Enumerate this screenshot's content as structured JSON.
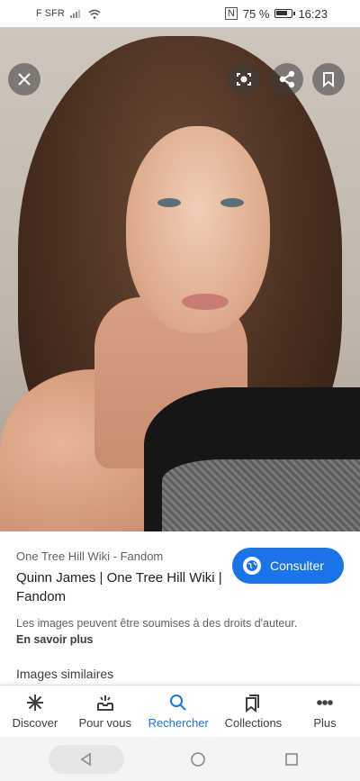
{
  "status_bar": {
    "carrier": "F SFR",
    "battery_percent": "75 %",
    "time": "16:23"
  },
  "hero": {
    "buttons": {
      "close": "close-icon",
      "lens": "lens-icon",
      "share": "share-icon",
      "bookmark": "bookmark-icon"
    }
  },
  "result": {
    "source": "One Tree Hill Wiki - Fandom",
    "title": "Quinn James | One Tree Hill Wiki | Fandom",
    "consult_label": "Consulter",
    "rights_text": "Les images peuvent être soumises à des droits d'auteur.",
    "learn_more": "En savoir plus",
    "similar_heading": "Images similaires"
  },
  "bottom_nav": {
    "items": [
      {
        "label": "Discover",
        "icon": "asterisk-icon"
      },
      {
        "label": "Pour vous",
        "icon": "inbox-icon"
      },
      {
        "label": "Rechercher",
        "icon": "search-icon",
        "active": true
      },
      {
        "label": "Collections",
        "icon": "collections-icon"
      },
      {
        "label": "Plus",
        "icon": "more-dots-icon"
      }
    ]
  },
  "colors": {
    "accent": "#1a73e8",
    "text": "#202124",
    "secondary_text": "#5f6368"
  }
}
